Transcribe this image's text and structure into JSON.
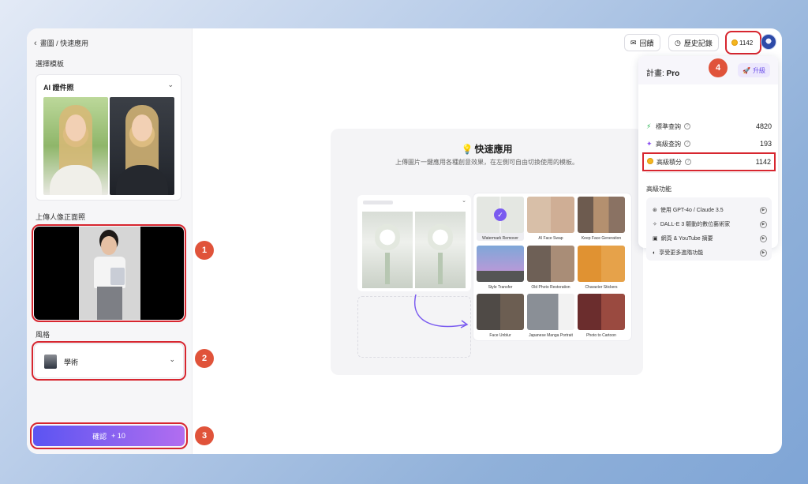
{
  "breadcrumb": {
    "back": "‹",
    "path": "畫圖 / 快速應用"
  },
  "left": {
    "template_label": "選擇模板",
    "template_value": "AI 證件照",
    "upload_label": "上傳人像正面照",
    "style_label": "風格",
    "style_value": "學術",
    "confirm_label": "確認",
    "confirm_cost": "+ 10"
  },
  "markers": [
    "1",
    "2",
    "3",
    "4"
  ],
  "toolbar": {
    "feedback": "回饋",
    "history": "歷史記錄",
    "credits": "1142"
  },
  "quick": {
    "title": "快速應用",
    "subtitle": "上傳圖片一鍵應用各種創意效果，在左側可自由切換使用的模板。",
    "tools": [
      "Watermark Remover",
      "AI Face Swap",
      "Keep Face Generation",
      "Style Transfer",
      "Old Photo Restoration",
      "Character Stickers",
      "Face Unblur",
      "Japanese Manga Portrait",
      "Photo to Cartoon"
    ]
  },
  "plan": {
    "label": "計畫:",
    "name": "Pro",
    "upgrade": "升級",
    "rows": [
      {
        "label": "標準查詢",
        "value": "4820"
      },
      {
        "label": "高級查詢",
        "value": "193"
      },
      {
        "label": "高級積分",
        "value": "1142"
      }
    ],
    "advanced_label": "高級功能",
    "features": [
      "使用 GPT-4o / Claude 3.5",
      "DALL-E 3 驅動的數位藝術家",
      "網頁 & YouTube 摘要",
      "享受更多進階功能"
    ]
  },
  "colors": {
    "accent": "#6b4fe8",
    "highlight": "#d7262f",
    "marker": "#e0533a"
  }
}
